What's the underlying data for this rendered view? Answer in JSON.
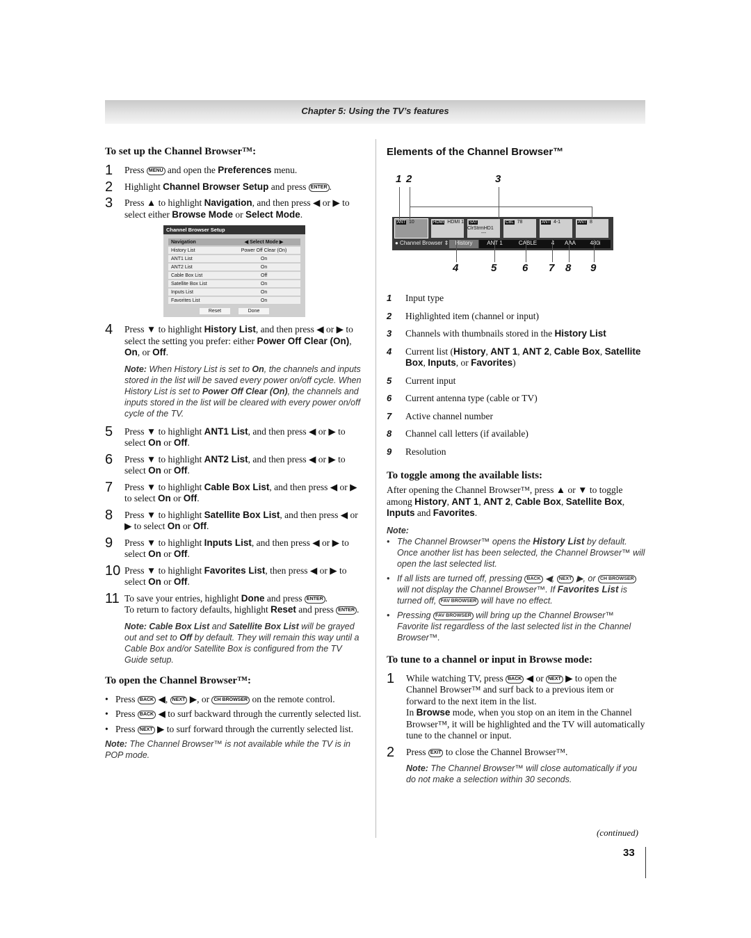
{
  "chapter": "Chapter 5: Using the TV’s features",
  "left": {
    "heading": "To set up the Channel Browser™:",
    "steps": [
      {
        "n": "1",
        "t": [
          "Press ",
          {
            "k": "MENU"
          },
          " and open the ",
          {
            "b": "Preferences"
          },
          " menu."
        ]
      },
      {
        "n": "2",
        "t": [
          "Highlight ",
          {
            "b": "Channel Browser Setup"
          },
          " and press ",
          {
            "k": "ENTER"
          },
          "."
        ]
      },
      {
        "n": "3",
        "t": [
          "Press ▲ to highlight ",
          {
            "b": "Navigation"
          },
          ", and then press ◀ or ▶ to select either ",
          {
            "b": "Browse Mode"
          },
          " or ",
          {
            "b": "Select Mode"
          },
          "."
        ]
      }
    ],
    "menu": {
      "title": "Channel Browser Setup",
      "rows": [
        [
          "Navigation",
          "◀   Select Mode   ▶"
        ],
        [
          "History List",
          "Power Off Clear (On)"
        ],
        [
          "ANT1 List",
          "On"
        ],
        [
          "ANT2 List",
          "On"
        ],
        [
          "Cable Box List",
          "Off"
        ],
        [
          "Satellite Box List",
          "On"
        ],
        [
          "Inputs List",
          "On"
        ],
        [
          "Favorites List",
          "On"
        ]
      ],
      "reset": "Reset",
      "done": "Done"
    },
    "steps2": [
      {
        "n": "4",
        "t": [
          "Press ▼ to highlight ",
          {
            "b": "History List"
          },
          ", and then press ◀ or ▶ to select the setting you prefer: either ",
          {
            "b": "Power Off Clear (On)"
          },
          ", ",
          {
            "b": "On"
          },
          ", or ",
          {
            "b": "Off"
          },
          "."
        ]
      }
    ],
    "note1": [
      {
        "b": "Note:"
      },
      " When History List is set to ",
      {
        "b": "On"
      },
      ", the channels and inputs stored in the list will be saved every power on/off cycle. When History List is set to ",
      {
        "b": "Power Off Clear (On)"
      },
      ", the channels and inputs stored in the list will be cleared with every power on/off cycle of the TV."
    ],
    "steps3": [
      {
        "n": "5",
        "t": [
          "Press ▼ to highlight ",
          {
            "b": "ANT1 List"
          },
          ", and then press ◀ or ▶ to select ",
          {
            "b": "On"
          },
          " or ",
          {
            "b": "Off"
          },
          "."
        ]
      },
      {
        "n": "6",
        "t": [
          "Press ▼ to highlight ",
          {
            "b": "ANT2 List"
          },
          ", and then press ◀ or ▶ to select ",
          {
            "b": "On"
          },
          " or ",
          {
            "b": "Off"
          },
          "."
        ]
      },
      {
        "n": "7",
        "t": [
          "Press ▼ to highlight ",
          {
            "b": "Cable Box List"
          },
          ", and then press ◀ or ▶ to select ",
          {
            "b": "On"
          },
          " or ",
          {
            "b": "Off"
          },
          "."
        ]
      },
      {
        "n": "8",
        "t": [
          "Press ▼ to highlight ",
          {
            "b": "Satellite Box List"
          },
          ", and then press ◀ or ▶ to select ",
          {
            "b": "On"
          },
          " or ",
          {
            "b": "Off"
          },
          "."
        ]
      },
      {
        "n": "9",
        "t": [
          "Press ▼ to highlight ",
          {
            "b": "Inputs List"
          },
          ", and then press ◀ or ▶ to select ",
          {
            "b": "On"
          },
          " or ",
          {
            "b": "Off"
          },
          "."
        ]
      },
      {
        "n": "10",
        "t": [
          "Press ▼ to highlight ",
          {
            "b": "Favorites List"
          },
          ", then press ◀ or ▶ to select ",
          {
            "b": "On"
          },
          " or ",
          {
            "b": "Off"
          },
          "."
        ]
      },
      {
        "n": "11",
        "t": [
          "To save your entries, highlight ",
          {
            "b": "Done"
          },
          " and press ",
          {
            "k": "ENTER"
          },
          ".",
          {
            "br": 1
          },
          "To return to factory defaults, highlight ",
          {
            "b": "Reset"
          },
          " and press ",
          {
            "k": "ENTER"
          },
          "."
        ]
      }
    ],
    "note2": [
      {
        "b": "Note: Cable Box List"
      },
      " and ",
      {
        "b": "Satellite Box List"
      },
      " will be grayed out and set to ",
      {
        "b": "Off"
      },
      " by default. They will remain this way until a Cable Box and/or Satellite Box is configured from the TV Guide setup."
    ],
    "heading2": "To open the Channel Browser™:",
    "bullets": [
      [
        "Press ",
        {
          "k": "BACK"
        },
        " ◀, ",
        {
          "k": "NEXT"
        },
        " ▶, or ",
        {
          "k": "CH BROWSER"
        },
        " on the remote control."
      ],
      [
        "Press ",
        {
          "k": "BACK"
        },
        " ◀ to surf backward through the currently selected list."
      ],
      [
        "Press ",
        {
          "k": "NEXT"
        },
        " ▶ to surf forward through the currently selected list."
      ]
    ],
    "note3": [
      {
        "b": "Note:"
      },
      " The Channel Browser™ is not available while the TV is in POP mode."
    ]
  },
  "right": {
    "heading": "Elements of the Channel Browser™",
    "diagram": {
      "callouts": [
        "1",
        "2",
        "3",
        "4",
        "5",
        "6",
        "7",
        "8",
        "9"
      ],
      "thumbs": [
        {
          "icon": "ANT",
          "label": "10"
        },
        {
          "icon": "HDMI",
          "label": "HDMI 1"
        },
        {
          "icon": "SAT",
          "label": "ClrStrmHD1",
          "sub": "---"
        },
        {
          "icon": "CBL",
          "label": "78"
        },
        {
          "icon": "ANT",
          "label": "4-1"
        },
        {
          "icon": "ANT",
          "label": "8"
        }
      ],
      "status": {
        "name": "Channel Browser",
        "list": "History",
        "input": "ANT 1",
        "antenna": "CABLE",
        "channel": "4",
        "letters": "AAA",
        "res": "480i"
      }
    },
    "legend": [
      [
        "1",
        "Input type"
      ],
      [
        "2",
        "Highlighted item (channel or input)"
      ],
      [
        "3",
        [
          "Channels with thumbnails stored in the ",
          {
            "b": "History List"
          }
        ]
      ],
      [
        "4",
        [
          "Current list (",
          {
            "b": "History"
          },
          ", ",
          {
            "b": "ANT 1"
          },
          ", ",
          {
            "b": "ANT 2"
          },
          ", ",
          {
            "b": "Cable Box"
          },
          ", ",
          {
            "b": "Satellite Box"
          },
          ", ",
          {
            "b": "Inputs"
          },
          ", or ",
          {
            "b": "Favorites"
          },
          ")"
        ]
      ],
      [
        "5",
        "Current input"
      ],
      [
        "6",
        "Current antenna type (cable or TV)"
      ],
      [
        "7",
        "Active channel number"
      ],
      [
        "8",
        "Channel call letters (if available)"
      ],
      [
        "9",
        "Resolution"
      ]
    ],
    "heading2": "To toggle among the available lists:",
    "para": [
      "After opening the Channel Browser™, press ▲ or ▼ to toggle among ",
      {
        "b": "History"
      },
      ", ",
      {
        "b": "ANT 1"
      },
      ", ",
      {
        "b": "ANT 2"
      },
      ", ",
      {
        "b": "Cable Box"
      },
      ", ",
      {
        "b": "Satellite Box"
      },
      ", ",
      {
        "b": "Inputs"
      },
      " and ",
      {
        "b": "Favorites"
      },
      "."
    ],
    "note_label": "Note:",
    "notes": [
      [
        "The Channel Browser™ opens the ",
        {
          "b": "History List"
        },
        " by default. Once another list has been selected, the Channel Browser™ will open the last selected list."
      ],
      [
        "If all lists are turned off, pressing ",
        {
          "k": "BACK"
        },
        " ◀, ",
        {
          "k": "NEXT"
        },
        " ▶, or ",
        {
          "k": "CH BROWSER"
        },
        " will not display the Channel Browser™. If ",
        {
          "b": "Favorites List"
        },
        " is turned off, ",
        {
          "k": "FAV BROWSER"
        },
        " will have no effect."
      ],
      [
        "Pressing ",
        {
          "k": "FAV BROWSER"
        },
        " will bring up the Channel Browser™ Favorite list regardless of the last selected list in the Channel Browser™."
      ]
    ],
    "heading3": "To tune to a channel or input in Browse mode:",
    "steps": [
      {
        "n": "1",
        "t": [
          "While watching TV, press ",
          {
            "k": "BACK"
          },
          " ◀ or ",
          {
            "k": "NEXT"
          },
          " ▶ to open the Channel Browser™ and surf back to a previous item or forward to the next item in the list.",
          {
            "br": 1
          },
          "In ",
          {
            "b": "Browse"
          },
          " mode, when you stop on an item in the Channel Browser™, it will be highlighted and the TV will automatically tune to the channel or input."
        ]
      },
      {
        "n": "2",
        "t": [
          "Press ",
          {
            "k": "EXIT"
          },
          " to close the Channel Browser™."
        ]
      }
    ],
    "note": [
      {
        "b": "Note:"
      },
      " The Channel Browser™ will close automatically if you do not make a selection within 30 seconds."
    ]
  },
  "continued": "(continued)",
  "page_number": "33"
}
